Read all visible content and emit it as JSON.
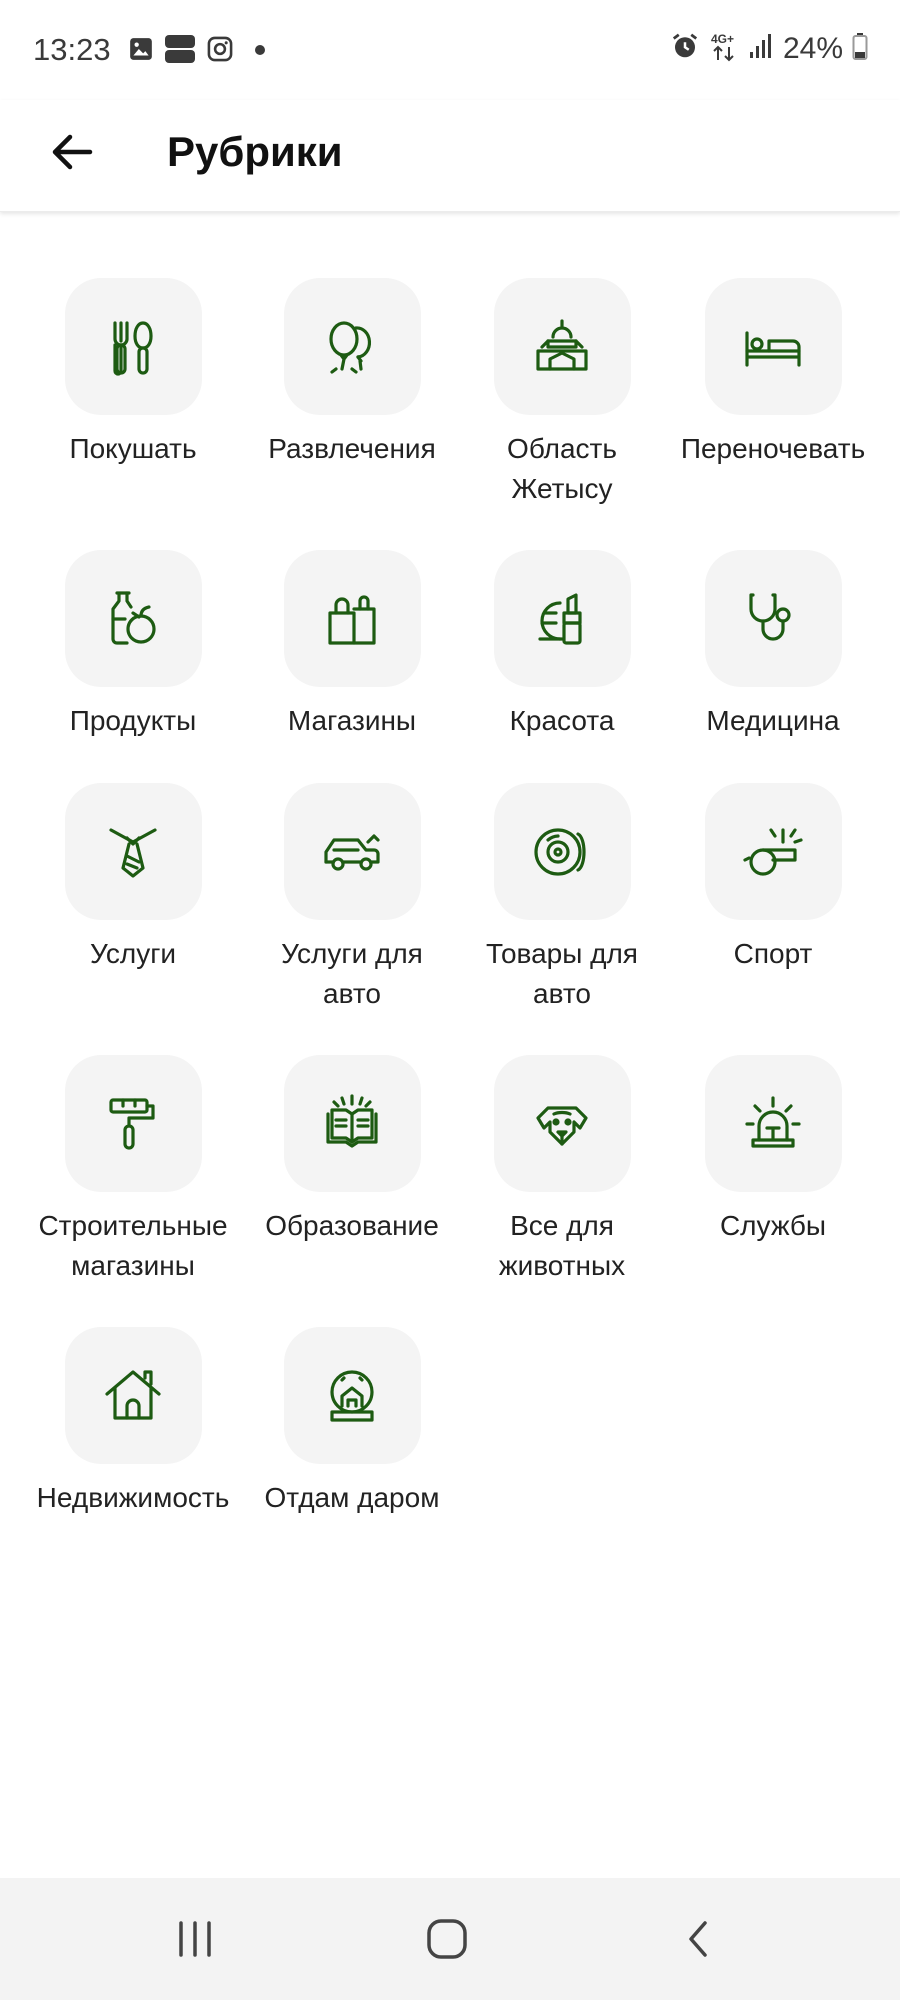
{
  "status_bar": {
    "time": "13:23",
    "battery": "24%",
    "network": "4G+",
    "icons": [
      "gallery-icon",
      "app-icon",
      "instagram-icon",
      "dot-icon",
      "alarm-icon",
      "network-icon",
      "signal-icon",
      "battery-icon"
    ]
  },
  "header": {
    "title": "Рубрики",
    "back_icon": "arrow-left-icon"
  },
  "colors": {
    "accent": "#1d5b12",
    "tile_bg": "#f4f4f4"
  },
  "categories": [
    {
      "label": "Покушать",
      "icon": "fork-spoon-icon"
    },
    {
      "label": "Развлечения",
      "icon": "balloons-icon"
    },
    {
      "label": "Область\nЖетысу",
      "icon": "building-icon"
    },
    {
      "label": "Переночевать",
      "icon": "bed-icon"
    },
    {
      "label": "Продукты",
      "icon": "groceries-icon"
    },
    {
      "label": "Магазины",
      "icon": "shopping-bags-icon"
    },
    {
      "label": "Красота",
      "icon": "lipstick-icon"
    },
    {
      "label": "Медицина",
      "icon": "stethoscope-icon"
    },
    {
      "label": "Услуги",
      "icon": "tie-icon"
    },
    {
      "label": "Услуги для\nавто",
      "icon": "car-icon"
    },
    {
      "label": "Товары для\nавто",
      "icon": "brake-disc-icon"
    },
    {
      "label": "Спорт",
      "icon": "whistle-icon"
    },
    {
      "label": "Строительные\nмагазины",
      "icon": "paint-roller-icon"
    },
    {
      "label": "Образование",
      "icon": "open-book-icon"
    },
    {
      "label": "Все для\nживотных",
      "icon": "dog-icon"
    },
    {
      "label": "Службы",
      "icon": "siren-icon"
    },
    {
      "label": "Недвижимость",
      "icon": "house-icon"
    },
    {
      "label": "Отдам даром",
      "icon": "snow-globe-icon"
    }
  ],
  "nav_bar": {
    "recent_icon": "recent-apps-icon",
    "home_icon": "home-icon",
    "back_icon": "back-icon"
  }
}
